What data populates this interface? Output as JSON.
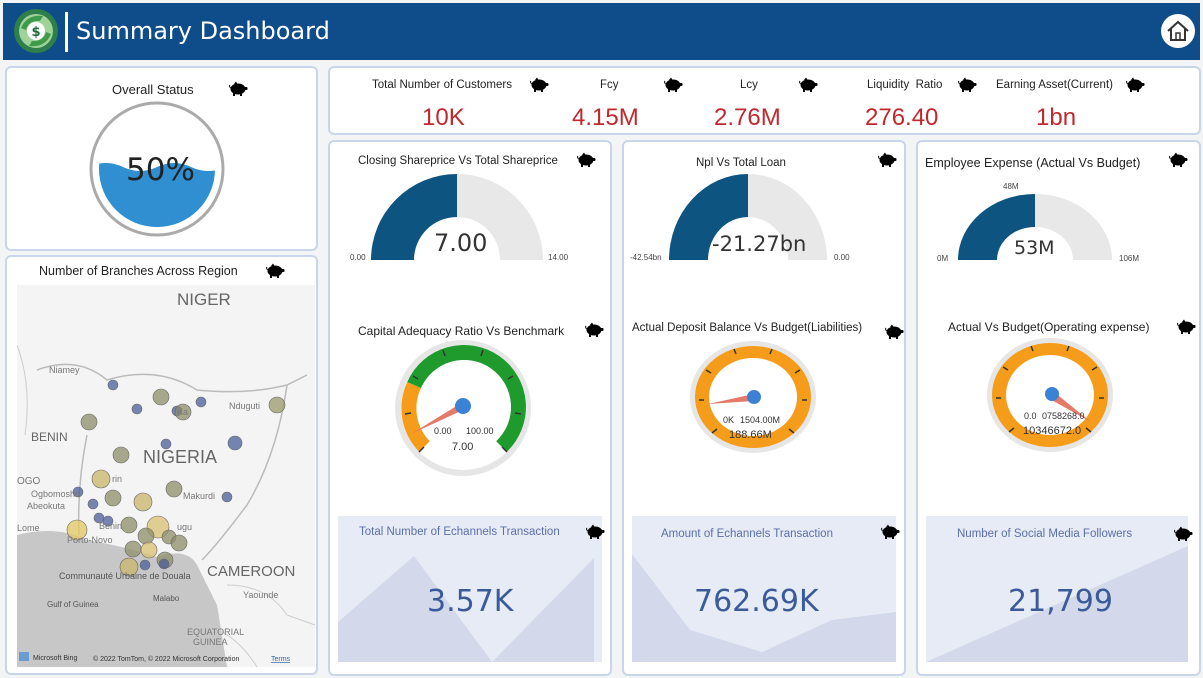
{
  "header": {
    "title": "Summary Dashboard"
  },
  "overall_status": {
    "title": "Overall Status",
    "value": "50%",
    "fill_fraction": 0.5
  },
  "kpis": [
    {
      "label": "Total Number of Customers",
      "value": "10K"
    },
    {
      "label": "Fcy",
      "value": "4.15M"
    },
    {
      "label": "Lcy",
      "value": "2.76M"
    },
    {
      "label": "Liquidity  Ratio",
      "value": "276.40"
    },
    {
      "label": "Earning Asset(Current)",
      "value": "1bn"
    }
  ],
  "map": {
    "title": "Number of Branches Across Region",
    "labels": {
      "niger": "NIGER",
      "nigeria": "NIGERIA",
      "benin": "BENIN",
      "cameroon": "CAMEROON",
      "niamey": "Niamey",
      "ogbomosho": "Ogbomosho",
      "abeokuta": "Abeokuta",
      "lome": "Lome",
      "porto_novo": "Porto-Novo",
      "makurdi": "Makurdi",
      "nduguti": "Nduguti",
      "kano": "Ka",
      "douala": "Communauté Urbaine de Douala",
      "gulf": "Gulf of Guinea",
      "malabo": "Malabo",
      "yaounde": "Yaounde",
      "equatorial": "EQUATORIAL",
      "guinea": "GUINEA",
      "bing": "Microsoft Bing",
      "copyright": "© 2022 TomTom, © 2022 Microsoft Corporation",
      "terms": "Terms",
      "ogo": "OGO",
      "arin": "rin",
      "enugu": "ugu",
      "benin_city": "Benin",
      "akure": "Ake"
    }
  },
  "gauges": [
    {
      "title": "Closing Shareprice Vs Total Shareprice",
      "value": "7.00",
      "min": "0.00",
      "max": "14.00",
      "fraction": 0.5
    },
    {
      "title": "Npl Vs Total Loan",
      "value": "-21.27bn",
      "min": "-42.54bn",
      "max": "0.00",
      "fraction": 0.5
    },
    {
      "title": "Employee Expense (Actual Vs Budget)",
      "value": "53M",
      "min": "0M",
      "max": "106M",
      "target": "48M",
      "fraction": 0.5
    }
  ],
  "dials": [
    {
      "title": "Capital Adequacy Ratio Vs Benchmark",
      "min": "0.00",
      "max": "100.00",
      "value": "7.00"
    },
    {
      "title": "Actual Deposit Balance Vs Budget(Liabilities)",
      "min": "0K",
      "max": "1504.00M",
      "value": "188.66M"
    },
    {
      "title": "Actual Vs Budget(Operating expense)",
      "min": "0.0",
      "max": "0758268.0",
      "value": "10346672.0"
    }
  ],
  "areas": [
    {
      "title": "Total Number of Echannels Transaction",
      "value": "3.57K"
    },
    {
      "title": "Amount of Echannels Transaction",
      "value": "762.69K"
    },
    {
      "title": "Number of Social Media Followers",
      "value": "21,799"
    }
  ],
  "colors": {
    "header": "#0f4c8a",
    "kpi": "#c0282d",
    "gauge": "#0e5480",
    "dial": "#f59c1a",
    "green": "#1f9a2c"
  }
}
